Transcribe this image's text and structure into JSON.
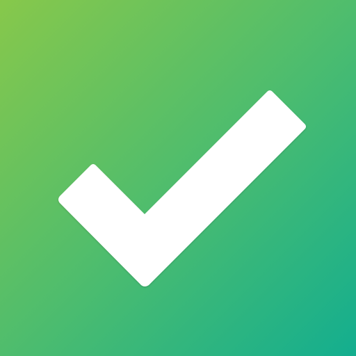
{
  "icon": {
    "name": "checkmark-icon",
    "background": {
      "start_color": "#87c84b",
      "end_color": "#13ae8f"
    },
    "glyph_color": "#ffffff"
  }
}
